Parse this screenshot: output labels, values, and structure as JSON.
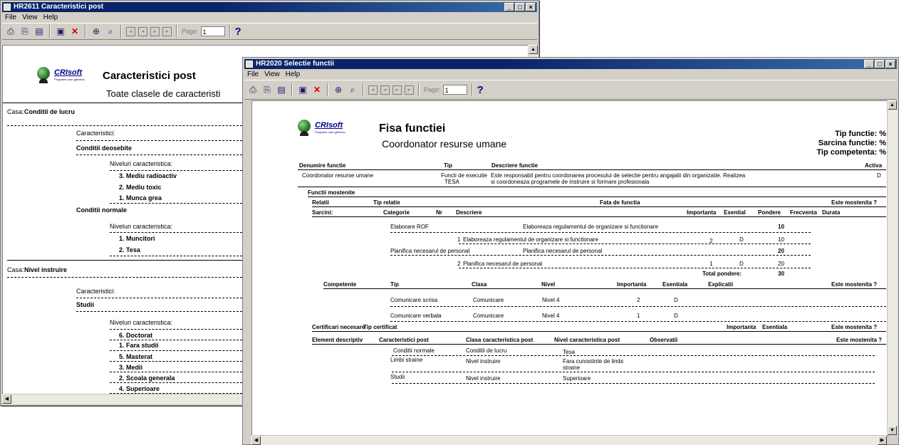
{
  "win1": {
    "title": "HR2611   Caracteristici post",
    "menu": [
      "File",
      "View",
      "Help"
    ],
    "page_label": "Page:",
    "page_value": "1",
    "help": "?",
    "logo": "CRIsoft",
    "logo_tag": "Programe care gândesc",
    "report_title": "Caracteristici post",
    "report_subtitle": "Toate clasele de caracteristi",
    "clase": [
      {
        "label": "Casa:",
        "name": "Conditii de lucru",
        "car_label": "Caracteristici:",
        "groups": [
          {
            "name": "Conditii deosebite",
            "niv_label": "Niveluri caracteristica:",
            "levels": [
              "3. Mediu radioactiv",
              "2. Mediu toxic",
              "1. Munca grea"
            ]
          },
          {
            "name": "Conditii normale",
            "niv_label": "Niveluri caracteristica:",
            "levels": [
              "1. Muncitori",
              "2. Tesa"
            ]
          }
        ]
      },
      {
        "label": "Casa:",
        "name": "Nivel instruire",
        "car_label": "Caracteristici:",
        "groups": [
          {
            "name": "Studii",
            "niv_label": "Niveluri caracteristica:",
            "levels": [
              "6. Doctorat",
              "1. Fara studii",
              "5. Masterat",
              "3. Medii",
              "2. Scoala generala",
              "4. Superioare"
            ]
          }
        ]
      }
    ]
  },
  "win2": {
    "title": "HR2020   Selectie functii",
    "menu": [
      "File",
      "View",
      "Help"
    ],
    "page_label": "Page:",
    "page_value": "1",
    "help": "?",
    "logo": "CRIsoft",
    "logo_tag": "Programe care gândesc",
    "report_title": "Fisa functiei",
    "report_subtitle": "Coordonator resurse umane",
    "right_info": [
      "Tip functie: %",
      "Sarcina functie: %",
      "Tip competenta: %"
    ],
    "main_headers": {
      "denumire": "Denumire functie",
      "tip": "Tip",
      "descriere": "Descriere functie",
      "activa": "Activa"
    },
    "main_row": {
      "denumire": "Coordonator resurse umane",
      "tip1": "Functi de executie",
      "tip2": "TESA",
      "desc1": "Este responsabil pentru coordonarea procesului de selectie pentru angajatii din organizatie. Realizea",
      "desc2": "si coordoneaza programele de instruire si formare profesionala",
      "activa": "D"
    },
    "mostenite": {
      "label": "Functii mostenite",
      "relatii": "Relatii",
      "tip_relatie": "Tip relatie",
      "fata": "Fata de functia",
      "este_mostenita": "Este mostenita ?"
    },
    "sarcini": {
      "label": "Sarcini:",
      "headers": {
        "categorie": "Categorie",
        "nr": "Nr",
        "descriere": "Descriere",
        "importanta": "Importanta",
        "esential": "Esential",
        "pondere": "Pondere",
        "frecventa": "Frecventa",
        "durata": "Durata"
      },
      "rows": [
        {
          "categorie": "Elaborare ROF",
          "descriere": "Elaboreaza regulamentul de organizare si functionare",
          "pondere": "10"
        },
        {
          "nr": "1",
          "descriere": "Elaboreaza regulamentul de organizare si functionare",
          "importanta": "2",
          "esential": "D",
          "pondere": "10"
        },
        {
          "categorie": "Planifica necesarul de personal",
          "descriere": "Planifica necesarul de personal",
          "pondere": "20"
        },
        {
          "nr": "2",
          "descriere": "Planifica necesarul de personal",
          "importanta": "1",
          "esential": "D",
          "pondere": "20"
        }
      ],
      "total_label": "Total pondere:",
      "total_value": "30"
    },
    "competente": {
      "label": "Competente",
      "headers": {
        "tip": "Tip",
        "clasa": "Clasa",
        "nivel": "Nivel",
        "importanta": "Importanta",
        "esentiala": "Esentiala",
        "explicatii": "Explicatii",
        "mostenita": "Este mostenita ?"
      },
      "rows": [
        {
          "tip": "Comunicare scrisa",
          "clasa": "Comunicare",
          "nivel": "Nivel 4",
          "importanta": "2",
          "esentiala": "D"
        },
        {
          "tip": "Comunicare verbala",
          "clasa": "Comunicare",
          "nivel": "Nivel 4",
          "importanta": "1",
          "esentiala": "D"
        }
      ]
    },
    "certificari": {
      "label": "Certificari necesare",
      "tip": "Tip certificat",
      "importanta": "Importanta",
      "esentiala": "Esentiala",
      "mostenita": "Este mostenita ?"
    },
    "elemente": {
      "headers": {
        "element": "Element descriptiv",
        "caracteristici": "Caracteristici post",
        "clasa": "Clasa caracteristica post",
        "nivel": "Nivel caracteristica post",
        "observatii": "Observatii",
        "mostenita": "Este mostenita ?"
      },
      "rows": [
        {
          "caracteristici": "Conditii normale",
          "clasa": "Conditii de lucru",
          "nivel1": "Tesa",
          "nivel2": ""
        },
        {
          "caracteristici": "Limbi straine",
          "clasa": "Nivel instruire",
          "nivel1": "Fara cunostinte de limbi",
          "nivel2": "straine"
        },
        {
          "caracteristici": "Studii",
          "clasa": "Nivel instruire",
          "nivel1": "Superioare",
          "nivel2": ""
        }
      ]
    }
  }
}
